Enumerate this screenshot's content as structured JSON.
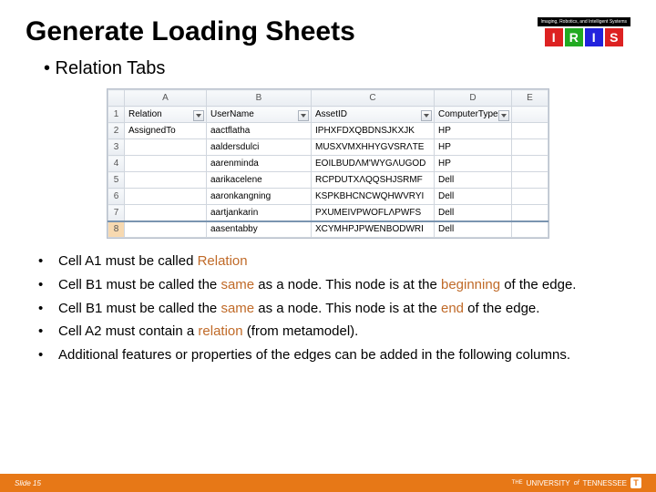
{
  "title": "Generate Loading Sheets",
  "logo": {
    "tag": "Imaging, Robotics, and Intelligent Systems",
    "letters": [
      "I",
      "R",
      "I",
      "S"
    ],
    "colors": [
      "#d22",
      "#2a2",
      "#22d",
      "#d22"
    ]
  },
  "subtitle": "• Relation Tabs",
  "sheet": {
    "cols": [
      "A",
      "B",
      "C",
      "D",
      "E"
    ],
    "header_row": [
      "Relation",
      "UserName",
      "AssetID",
      "ComputerType",
      ""
    ],
    "header_dd": [
      true,
      true,
      true,
      true,
      false
    ],
    "rows": [
      [
        "AssignedTo",
        "aactflatha",
        "IPHXFDXQBDNSJKXJK",
        "HP",
        ""
      ],
      [
        "",
        "aaldersdulci",
        "MUSXVMXHHYGVSRΛTE",
        "HP",
        ""
      ],
      [
        "",
        "aarenminda",
        "EOILBUDΛM'WYGΛUGOD",
        "HP",
        ""
      ],
      [
        "",
        "aarikacelene",
        "RCPDUTXΛQQSHJSRMF",
        "Dell",
        ""
      ],
      [
        "",
        "aaronkangning",
        "KSPKBHCNCWQHWVRYI",
        "Dell",
        ""
      ],
      [
        "",
        "aartjankarin",
        "PXUMEIVPWOFLΛPWFS",
        "Dell",
        ""
      ],
      [
        "",
        "aasentabby",
        "XCYMHPJPWENBODWRI",
        "Dell",
        ""
      ]
    ]
  },
  "bullets": [
    [
      {
        "t": "Cell A1 must be called "
      },
      {
        "t": "Relation",
        "c": "#c06a28"
      }
    ],
    [
      {
        "t": "Cell B1 must be called the "
      },
      {
        "t": "same",
        "c": "#c06a28"
      },
      {
        "t": " as a node. This node is at the "
      },
      {
        "t": "beginning",
        "c": "#c06a28"
      },
      {
        "t": " of the edge."
      }
    ],
    [
      {
        "t": "Cell B1 must be called the "
      },
      {
        "t": "same",
        "c": "#c06a28"
      },
      {
        "t": " as a node. This node is at the "
      },
      {
        "t": "end",
        "c": "#c06a28"
      },
      {
        "t": " of the edge."
      }
    ],
    [
      {
        "t": "Cell A2 must contain a "
      },
      {
        "t": "relation",
        "c": "#c06a28"
      },
      {
        "t": " (from metamodel)."
      }
    ],
    [
      {
        "t": "Additional features or properties of the edges can be added in the following columns."
      }
    ]
  ],
  "footer": {
    "slide": "Slide 15",
    "uni_pre": "THE",
    "uni_main": "UNIVERSITY",
    "uni_of": "of",
    "uni_tenn": "TENNESSEE"
  }
}
